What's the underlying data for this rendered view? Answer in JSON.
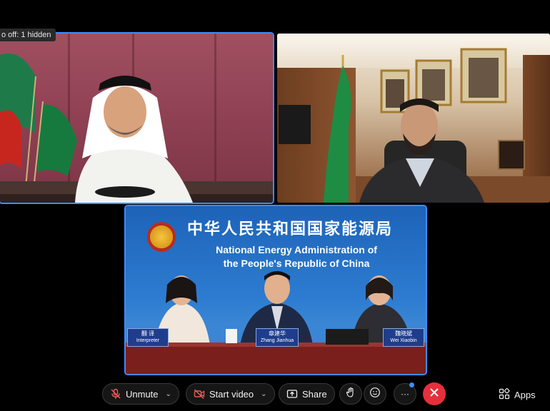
{
  "status": {
    "text": "o off: 1 hidden"
  },
  "tiles": {
    "top_left": {
      "active": true
    },
    "top_right": {
      "active": false
    },
    "center": {
      "title_cn": "中华人民共和国国家能源局",
      "title_en_line1": "National Energy Administration of",
      "title_en_line2": "the People's Republic of China",
      "nameplates": [
        {
          "title": "翻 译",
          "sub": "Interpreter"
        },
        {
          "title": "章建华",
          "sub": "Zhang Jianhua"
        },
        {
          "title": "魏晓斌",
          "sub": "Wei Xiaobin"
        }
      ]
    }
  },
  "toolbar": {
    "unmute_label": "Unmute",
    "start_video_label": "Start video",
    "share_label": "Share",
    "apps_label": "Apps",
    "more_label": "···"
  },
  "colors": {
    "accent": "#3f8cff",
    "leave": "#e5303c",
    "toolbar_bg": "#161616"
  }
}
